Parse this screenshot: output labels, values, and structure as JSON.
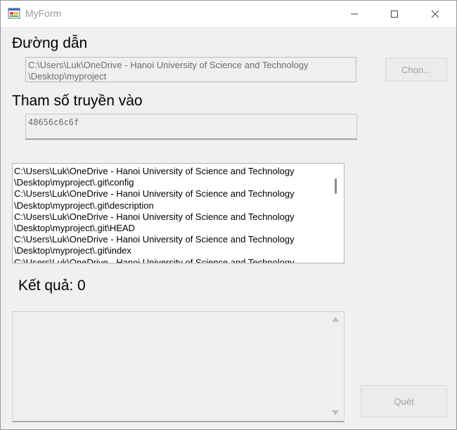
{
  "window": {
    "title": "MyForm",
    "icon": "winforms-app-icon"
  },
  "titlebar_buttons": {
    "minimize": "minimize-icon",
    "maximize": "maximize-icon",
    "close": "close-icon"
  },
  "path": {
    "label": "Đường dẫn",
    "value": "C:\\Users\\Luk\\OneDrive - Hanoi University of Science and Technology \\Desktop\\myproject",
    "browse_button": "Chọn..."
  },
  "param": {
    "label": "Tham số truyền vào",
    "value": "48656c6c6f"
  },
  "file_list": {
    "items": [
      "C:\\Users\\Luk\\OneDrive - Hanoi University of Science and Technology \\Desktop\\myproject\\.git\\config",
      "C:\\Users\\Luk\\OneDrive - Hanoi University of Science and Technology \\Desktop\\myproject\\.git\\description",
      "C:\\Users\\Luk\\OneDrive - Hanoi University of Science and Technology \\Desktop\\myproject\\.git\\HEAD",
      "C:\\Users\\Luk\\OneDrive - Hanoi University of Science and Technology \\Desktop\\myproject\\.git\\index",
      "C:\\Users\\Luk\\OneDrive - Hanoi University of Science and Technology"
    ]
  },
  "result": {
    "label": "Kết quả: 0"
  },
  "output": {
    "value": ""
  },
  "scan_button": "Quét"
}
